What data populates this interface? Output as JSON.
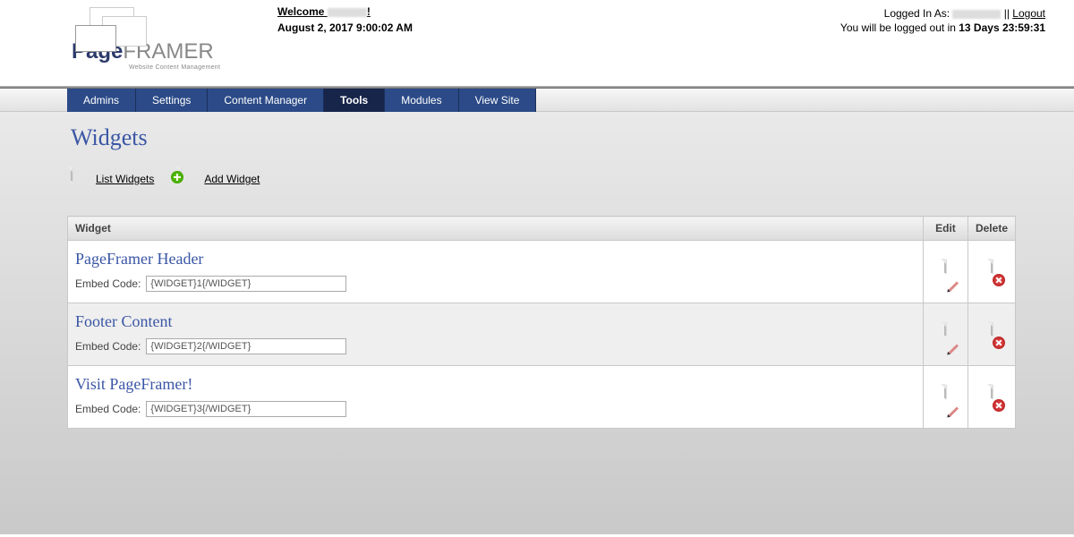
{
  "header": {
    "logo_page": "Page",
    "logo_framer": "FRAMER",
    "logo_sub": "Website Content Management",
    "welcome_prefix": "Welcome ",
    "welcome_suffix": "!",
    "datetime": "August 2, 2017 9:00:02 AM",
    "logged_in_label": "Logged In As: ",
    "separator": " || ",
    "logout": "Logout",
    "countdown_prefix": "You will be logged out in ",
    "countdown_value": "13 Days 23:59:31"
  },
  "nav": {
    "items": [
      {
        "label": "Admins",
        "active": false
      },
      {
        "label": "Settings",
        "active": false
      },
      {
        "label": "Content Manager",
        "active": false
      },
      {
        "label": "Tools",
        "active": true
      },
      {
        "label": "Modules",
        "active": false
      },
      {
        "label": "View Site",
        "active": false
      }
    ]
  },
  "page": {
    "title": "Widgets",
    "actions": {
      "list": "List Widgets",
      "add": "Add Widget"
    }
  },
  "table": {
    "headers": {
      "widget": "Widget",
      "edit": "Edit",
      "delete": "Delete"
    },
    "embed_label": "Embed Code:",
    "rows": [
      {
        "name": "PageFramer Header",
        "embed": "{WIDGET}1{/WIDGET}"
      },
      {
        "name": "Footer Content",
        "embed": "{WIDGET}2{/WIDGET}"
      },
      {
        "name": "Visit PageFramer!",
        "embed": "{WIDGET}3{/WIDGET}"
      }
    ]
  }
}
